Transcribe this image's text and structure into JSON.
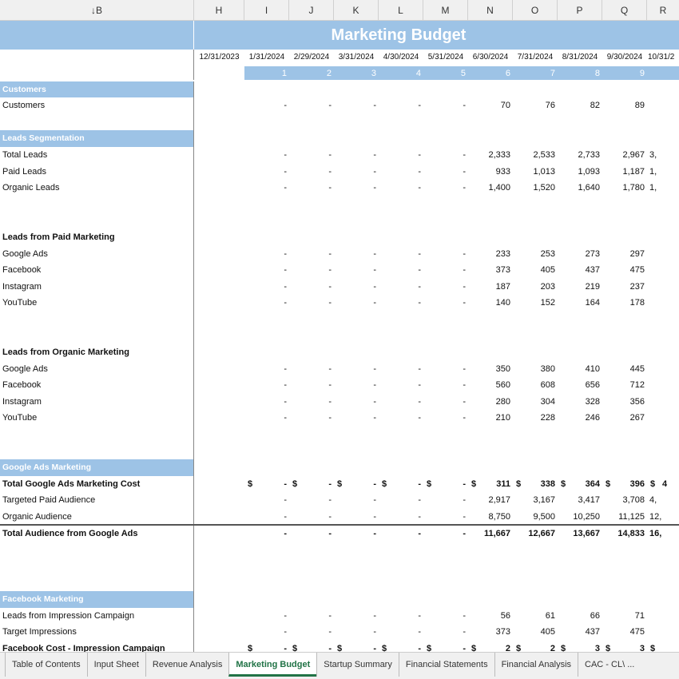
{
  "column_headers": [
    "B",
    "H",
    "I",
    "J",
    "K",
    "L",
    "M",
    "N",
    "O",
    "P",
    "Q",
    "R"
  ],
  "title": "Marketing Budget",
  "dates": [
    "12/31/2023",
    "1/31/2024",
    "2/29/2024",
    "3/31/2024",
    "4/30/2024",
    "5/31/2024",
    "6/30/2024",
    "7/31/2024",
    "8/31/2024",
    "9/30/2024",
    "10/31/2"
  ],
  "periods": [
    "1",
    "2",
    "3",
    "4",
    "5",
    "6",
    "7",
    "8",
    "9",
    ""
  ],
  "theme": {
    "section_fill": "#9dc3e6",
    "active_tab": "#217346"
  },
  "rows": [
    {
      "label": "Customers",
      "type": "section"
    },
    {
      "label": "Customers",
      "values": [
        "-",
        "-",
        "-",
        "-",
        "-",
        "70",
        "76",
        "82",
        "89",
        ""
      ]
    },
    {
      "label": ""
    },
    {
      "label": "Leads Segmentation",
      "type": "section"
    },
    {
      "label": "Total Leads",
      "values": [
        "-",
        "-",
        "-",
        "-",
        "-",
        "2,333",
        "2,533",
        "2,733",
        "2,967",
        "3,"
      ]
    },
    {
      "label": "Paid Leads",
      "values": [
        "-",
        "-",
        "-",
        "-",
        "-",
        "933",
        "1,013",
        "1,093",
        "1,187",
        "1,"
      ]
    },
    {
      "label": "Organic Leads",
      "values": [
        "-",
        "-",
        "-",
        "-",
        "-",
        "1,400",
        "1,520",
        "1,640",
        "1,780",
        "1,"
      ]
    },
    {
      "label": ""
    },
    {
      "label": ""
    },
    {
      "label": "Leads from Paid Marketing",
      "type": "bold"
    },
    {
      "label": "Google Ads",
      "values": [
        "-",
        "-",
        "-",
        "-",
        "-",
        "233",
        "253",
        "273",
        "297",
        ""
      ]
    },
    {
      "label": "Facebook",
      "values": [
        "-",
        "-",
        "-",
        "-",
        "-",
        "373",
        "405",
        "437",
        "475",
        ""
      ]
    },
    {
      "label": "Instagram",
      "values": [
        "-",
        "-",
        "-",
        "-",
        "-",
        "187",
        "203",
        "219",
        "237",
        ""
      ]
    },
    {
      "label": "YouTube",
      "values": [
        "-",
        "-",
        "-",
        "-",
        "-",
        "140",
        "152",
        "164",
        "178",
        ""
      ]
    },
    {
      "label": ""
    },
    {
      "label": ""
    },
    {
      "label": "Leads from Organic Marketing",
      "type": "bold"
    },
    {
      "label": "Google Ads",
      "values": [
        "-",
        "-",
        "-",
        "-",
        "-",
        "350",
        "380",
        "410",
        "445",
        ""
      ]
    },
    {
      "label": "Facebook",
      "values": [
        "-",
        "-",
        "-",
        "-",
        "-",
        "560",
        "608",
        "656",
        "712",
        ""
      ]
    },
    {
      "label": "Instagram",
      "values": [
        "-",
        "-",
        "-",
        "-",
        "-",
        "280",
        "304",
        "328",
        "356",
        ""
      ]
    },
    {
      "label": "YouTube",
      "values": [
        "-",
        "-",
        "-",
        "-",
        "-",
        "210",
        "228",
        "246",
        "267",
        ""
      ]
    },
    {
      "label": ""
    },
    {
      "label": ""
    },
    {
      "label": "Google Ads Marketing",
      "type": "section"
    },
    {
      "label": "Total Google Ads Marketing Cost",
      "type": "bold",
      "dollar": true,
      "values": [
        "-",
        "-",
        "-",
        "-",
        "-",
        "311",
        "338",
        "364",
        "396",
        "4"
      ]
    },
    {
      "label": "Targeted Paid Audience",
      "values": [
        "-",
        "-",
        "-",
        "-",
        "-",
        "2,917",
        "3,167",
        "3,417",
        "3,708",
        "4,"
      ]
    },
    {
      "label": "Organic Audience",
      "underline": true,
      "values": [
        "-",
        "-",
        "-",
        "-",
        "-",
        "8,750",
        "9,500",
        "10,250",
        "11,125",
        "12,"
      ]
    },
    {
      "label": "Total Audience from Google Ads",
      "type": "bold",
      "values": [
        "-",
        "-",
        "-",
        "-",
        "-",
        "11,667",
        "12,667",
        "13,667",
        "14,833",
        "16,"
      ]
    },
    {
      "label": ""
    },
    {
      "label": ""
    },
    {
      "label": ""
    },
    {
      "label": "Facebook Marketing",
      "type": "section"
    },
    {
      "label": "Leads from Impression Campaign",
      "values": [
        "-",
        "-",
        "-",
        "-",
        "-",
        "56",
        "61",
        "66",
        "71",
        ""
      ]
    },
    {
      "label": "Target Impressions",
      "values": [
        "-",
        "-",
        "-",
        "-",
        "-",
        "373",
        "405",
        "437",
        "475",
        ""
      ]
    },
    {
      "label": "Facebook Cost - Impression Campaign",
      "type": "bold",
      "dollar": true,
      "values": [
        "-",
        "-",
        "-",
        "-",
        "-",
        "2",
        "2",
        "3",
        "3",
        ""
      ]
    }
  ],
  "tabs": [
    {
      "label": "Table of Contents"
    },
    {
      "label": "Input Sheet"
    },
    {
      "label": "Revenue Analysis"
    },
    {
      "label": "Marketing Budget",
      "active": true
    },
    {
      "label": "Startup Summary"
    },
    {
      "label": "Financial Statements"
    },
    {
      "label": "Financial Analysis"
    },
    {
      "label": "CAC - CL\\ ..."
    }
  ]
}
